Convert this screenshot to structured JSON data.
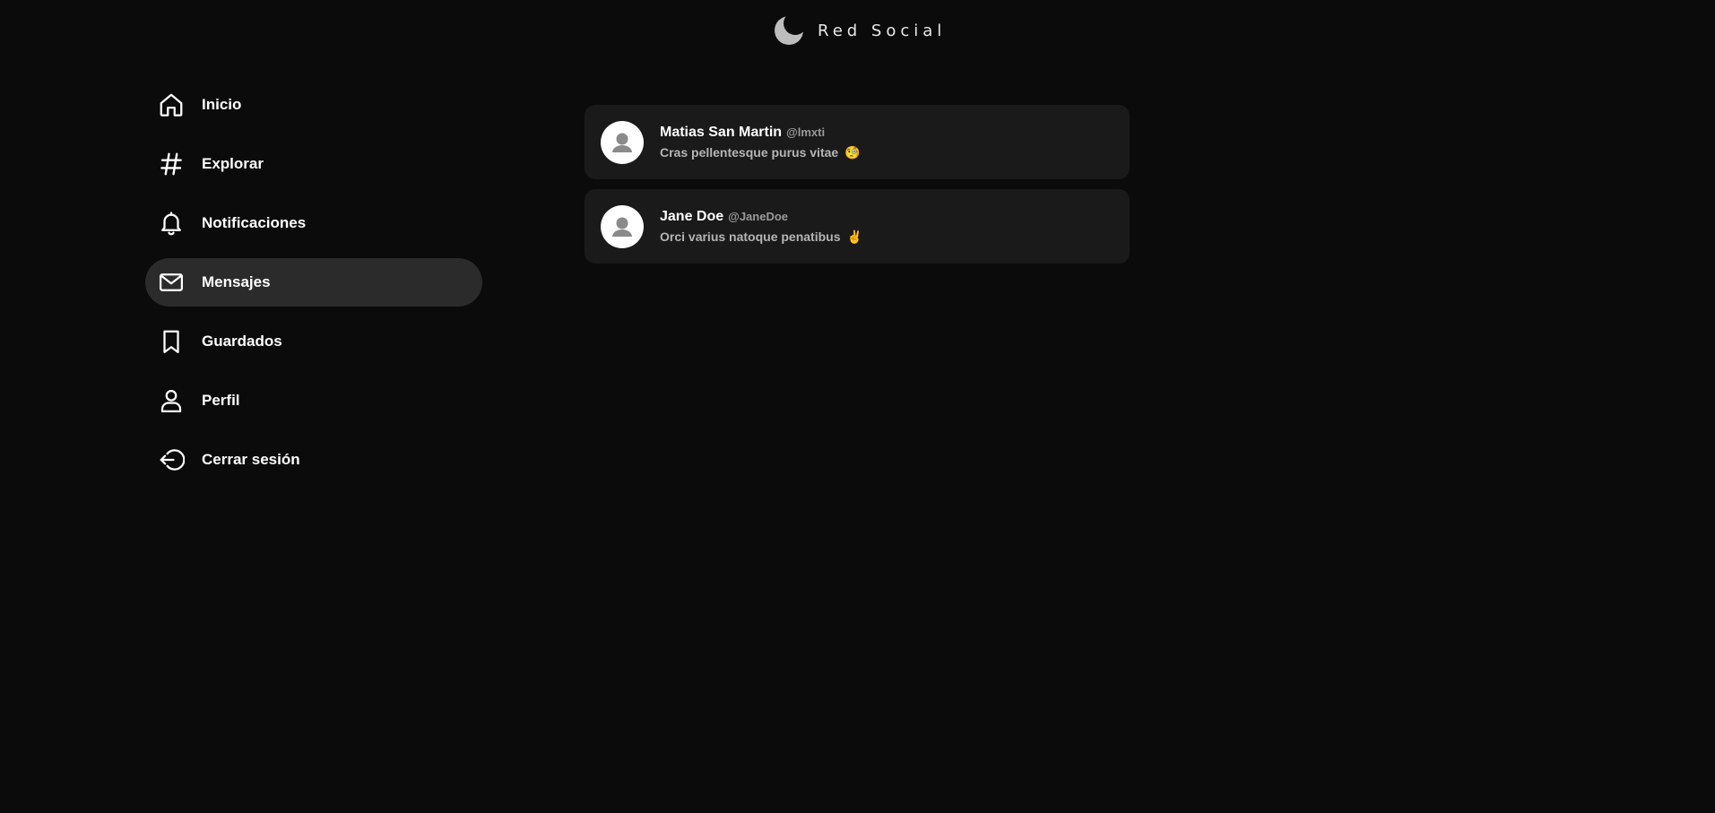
{
  "app": {
    "title": "Red Social",
    "logo_icon": "moon-icon"
  },
  "sidebar": {
    "items": [
      {
        "label": "Inicio",
        "icon": "home-icon",
        "active": false
      },
      {
        "label": "Explorar",
        "icon": "hashtag-icon",
        "active": false
      },
      {
        "label": "Notificaciones",
        "icon": "bell-icon",
        "active": false
      },
      {
        "label": "Mensajes",
        "icon": "mail-icon",
        "active": true
      },
      {
        "label": "Guardados",
        "icon": "bookmark-icon",
        "active": false
      },
      {
        "label": "Perfil",
        "icon": "user-icon",
        "active": false
      },
      {
        "label": "Cerrar sesión",
        "icon": "logout-icon",
        "active": false
      }
    ]
  },
  "conversations": [
    {
      "name": "Matias San Martin",
      "handle": "@lmxti",
      "message": "Cras pellentesque purus vitae",
      "emoji": "🧐",
      "avatar_icon": "default-avatar-icon"
    },
    {
      "name": "Jane Doe",
      "handle": "@JaneDoe",
      "message": "Orci varius natoque penatibus",
      "emoji": "✌",
      "avatar_icon": "default-avatar-icon"
    }
  ],
  "colors": {
    "background": "#0b0b0b",
    "card": "#1a1a1a",
    "active_nav": "#2b2b2b",
    "logo": "#bdbdbd",
    "text": "#ffffff",
    "muted": "#9a9a9a"
  }
}
